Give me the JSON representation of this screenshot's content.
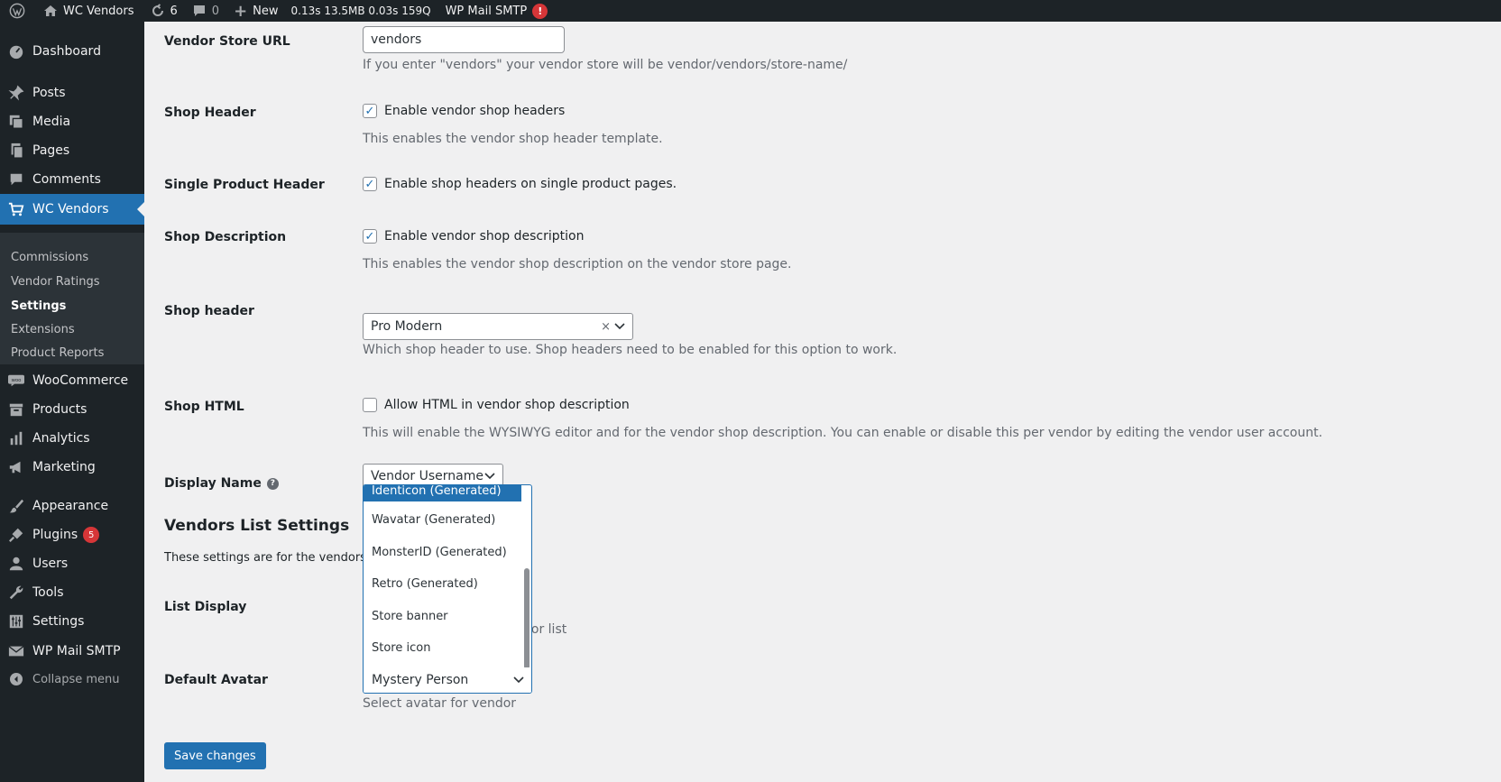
{
  "adminbar": {
    "site_name": "WC Vendors",
    "updates_count": "6",
    "comments_count": "0",
    "new_label": "New",
    "query_monitor": "0.13s 13.5MB 0.03s 159Q",
    "smtp_label": "WP Mail SMTP",
    "smtp_alert": "!"
  },
  "sidebar": {
    "dashboard": "Dashboard",
    "posts": "Posts",
    "media": "Media",
    "pages": "Pages",
    "comments": "Comments",
    "wc_vendors": "WC Vendors",
    "submenu": {
      "commissions": "Commissions",
      "vendor_ratings": "Vendor Ratings",
      "settings": "Settings",
      "extensions": "Extensions",
      "product_reports": "Product Reports"
    },
    "woocommerce": "WooCommerce",
    "products": "Products",
    "analytics": "Analytics",
    "marketing": "Marketing",
    "appearance": "Appearance",
    "plugins": "Plugins",
    "plugins_badge": "5",
    "users": "Users",
    "tools": "Tools",
    "settings": "Settings",
    "wp_mail_smtp": "WP Mail SMTP",
    "collapse": "Collapse menu"
  },
  "form": {
    "vendor_store_url": {
      "label": "Vendor Store URL",
      "value": "vendors",
      "desc": "If you enter \"vendors\" your vendor store will be vendor/vendors/store-name/"
    },
    "shop_header_enable": {
      "label": "Shop Header",
      "checkbox": "Enable vendor shop headers",
      "desc": "This enables the vendor shop header template."
    },
    "single_product_header": {
      "label": "Single Product Header",
      "checkbox": "Enable shop headers on single product pages."
    },
    "shop_description": {
      "label": "Shop Description",
      "checkbox": "Enable vendor shop description",
      "desc": "This enables the vendor shop description on the vendor store page."
    },
    "shop_header_select": {
      "label": "Shop header",
      "value": "Pro Modern",
      "clear": "×",
      "desc": "Which shop header to use. Shop headers need to be enabled for this option to work."
    },
    "shop_html": {
      "label": "Shop HTML",
      "checkbox": "Allow HTML in vendor shop description",
      "desc": "This will enable the WYSIWYG editor and for the vendor shop description. You can enable or disable this per vendor by editing the vendor user account."
    },
    "display_name": {
      "label": "Display Name",
      "value": "Vendor Username",
      "help": "?"
    },
    "vendors_list": {
      "title": "Vendors List Settings",
      "desc": "These settings are for the vendors list"
    },
    "list_display": {
      "label": "List Display",
      "partial": "dor list"
    },
    "default_avatar": {
      "label": "Default Avatar",
      "value": "Mystery Person",
      "desc": "Select avatar for vendor",
      "options": [
        "Identicon (Generated)",
        "Wavatar (Generated)",
        "MonsterID (Generated)",
        "Retro (Generated)",
        "Store banner",
        "Store icon"
      ]
    },
    "save": "Save changes"
  },
  "colors": {
    "accent": "#2271b1",
    "sidebar_bg": "#1d2327",
    "alert": "#d63638"
  }
}
